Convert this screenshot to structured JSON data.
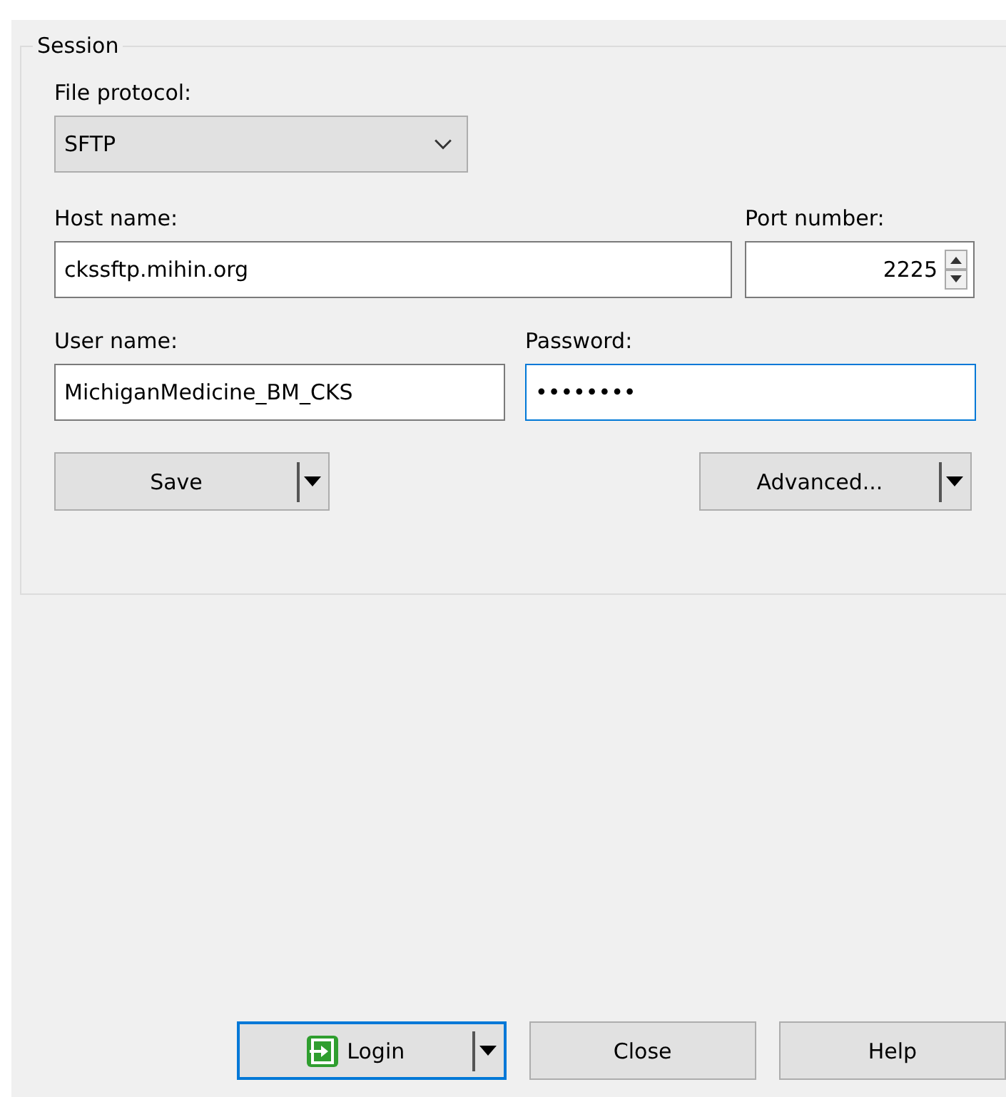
{
  "session": {
    "title": "Session",
    "file_protocol": {
      "label": "File protocol:",
      "value": "SFTP"
    },
    "host_name": {
      "label": "Host name:",
      "value": "ckssftp.mihin.org"
    },
    "port_number": {
      "label": "Port number:",
      "value": "2225"
    },
    "user_name": {
      "label": "User name:",
      "value": "MichiganMedicine_BM_CKS"
    },
    "password": {
      "label": "Password:",
      "value": "••••••••",
      "focused": true
    },
    "buttons": [
      {
        "label": "Save",
        "split": true
      },
      {
        "label": "Advanced...",
        "split": true
      }
    ]
  },
  "footer_buttons": [
    {
      "label": "Login",
      "kind": "login",
      "default": true,
      "split": true
    },
    {
      "label": "Close",
      "kind": "plain",
      "default": false,
      "split": false
    },
    {
      "label": "Help",
      "kind": "plain",
      "default": false,
      "split": false
    }
  ]
}
